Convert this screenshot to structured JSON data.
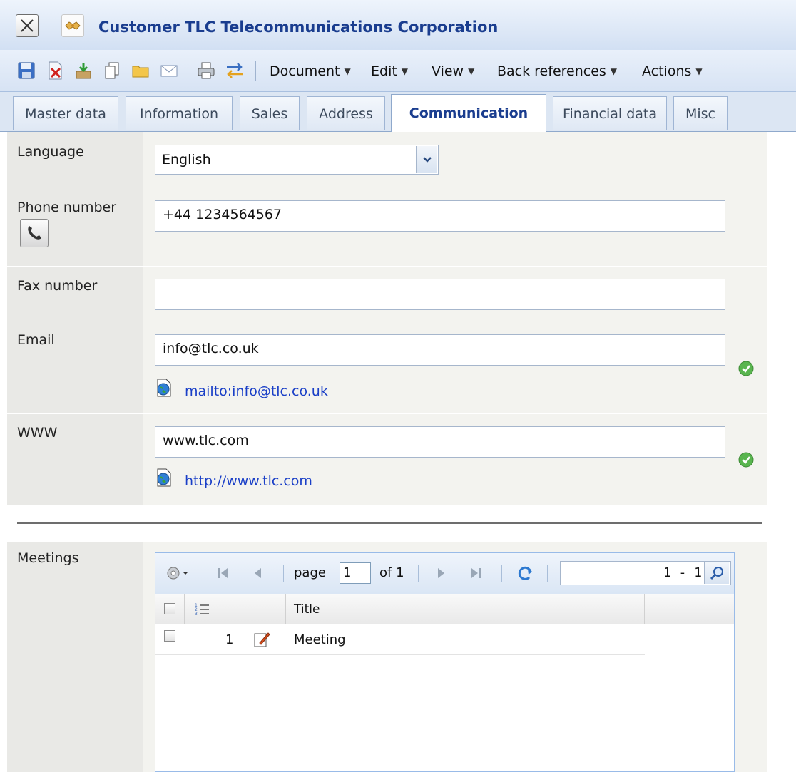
{
  "window": {
    "title": "Customer TLC Telecommunications Corporation"
  },
  "toolbar": {
    "icons": [
      "save-icon",
      "delete-icon",
      "import-icon",
      "copy-icon",
      "folder-icon",
      "email-icon",
      "print-icon",
      "transfer-icon"
    ],
    "menus": [
      {
        "label": "Document"
      },
      {
        "label": "Edit"
      },
      {
        "label": "View"
      },
      {
        "label": "Back references"
      },
      {
        "label": "Actions"
      }
    ]
  },
  "tabs": [
    {
      "label": "Master data",
      "active": false
    },
    {
      "label": "Information",
      "active": false
    },
    {
      "label": "Sales",
      "active": false
    },
    {
      "label": "Address",
      "active": false
    },
    {
      "label": "Communication",
      "active": true
    },
    {
      "label": "Financial data",
      "active": false
    },
    {
      "label": "Misc",
      "active": false
    }
  ],
  "form": {
    "language": {
      "label": "Language",
      "value": "English"
    },
    "phone": {
      "label": "Phone number",
      "value": "+44  1234564567"
    },
    "fax": {
      "label": "Fax number",
      "value": ""
    },
    "email": {
      "label": "Email",
      "value": "info@tlc.co.uk",
      "link": "mailto:info@tlc.co.uk"
    },
    "www": {
      "label": "WWW",
      "value": "www.tlc.com",
      "link": "http://www.tlc.com"
    },
    "meetings": {
      "label": "Meetings"
    }
  },
  "grid": {
    "pager": {
      "page_label": "page",
      "page_value": "1",
      "of_label": "of 1",
      "range": "1 - 1"
    },
    "columns": [
      "Title"
    ],
    "rows": [
      {
        "number": "1",
        "title": "Meeting"
      }
    ]
  },
  "colors": {
    "accent": "#1a3d8f",
    "link": "#1a3fc7",
    "valid": "#4caf50"
  }
}
